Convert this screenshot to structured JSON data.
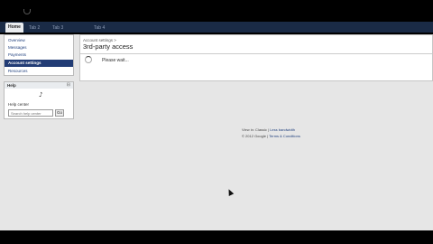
{
  "tabs": [
    {
      "label": "Home",
      "active": true
    },
    {
      "label": "Tab 2"
    },
    {
      "label": "Tab 3"
    },
    {
      "label": "Tab 4"
    }
  ],
  "sidebar": {
    "items": [
      {
        "label": "Overview"
      },
      {
        "label": "Messages"
      },
      {
        "label": "Payments"
      },
      {
        "label": "Account settings",
        "selected": true
      },
      {
        "label": "Resources"
      }
    ]
  },
  "help": {
    "title": "Help",
    "toggle": "⊟",
    "center_label": "Help center",
    "search_placeholder": "Search help center",
    "go_label": "Go"
  },
  "main": {
    "breadcrumb": "Account settings >",
    "title": "3rd-party access",
    "status": "Please wait..."
  },
  "footer": {
    "line1_prefix": "View in: Classic | ",
    "line1_link": "Less bandwidth",
    "line2_prefix": "© 2012 Google | ",
    "line2_link": "Terms & Conditions"
  },
  "colors": {
    "nav_bar": "#1a2b46",
    "selected": "#223c75",
    "background": "#e6e6e6"
  }
}
